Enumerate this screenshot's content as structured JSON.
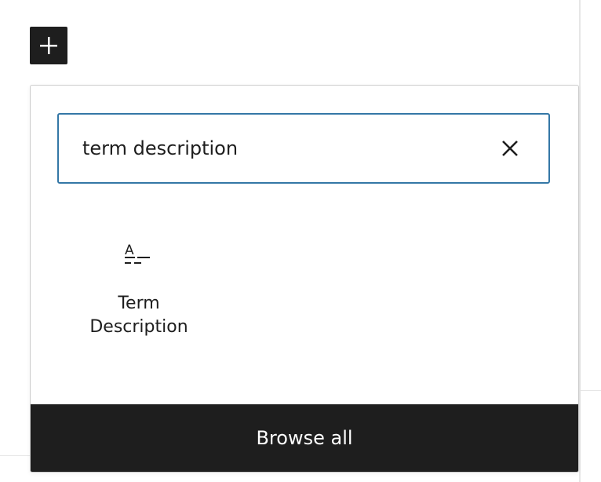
{
  "inserter": {
    "toggle_icon": "plus-icon"
  },
  "search": {
    "value": "term description",
    "clear_icon": "close-icon"
  },
  "results": [
    {
      "icon": "term-description-icon",
      "title": "Term Description"
    }
  ],
  "footer": {
    "browse_all_label": "Browse all"
  },
  "colors": {
    "accent": "#3477a6",
    "dark": "#1e1e1e"
  }
}
